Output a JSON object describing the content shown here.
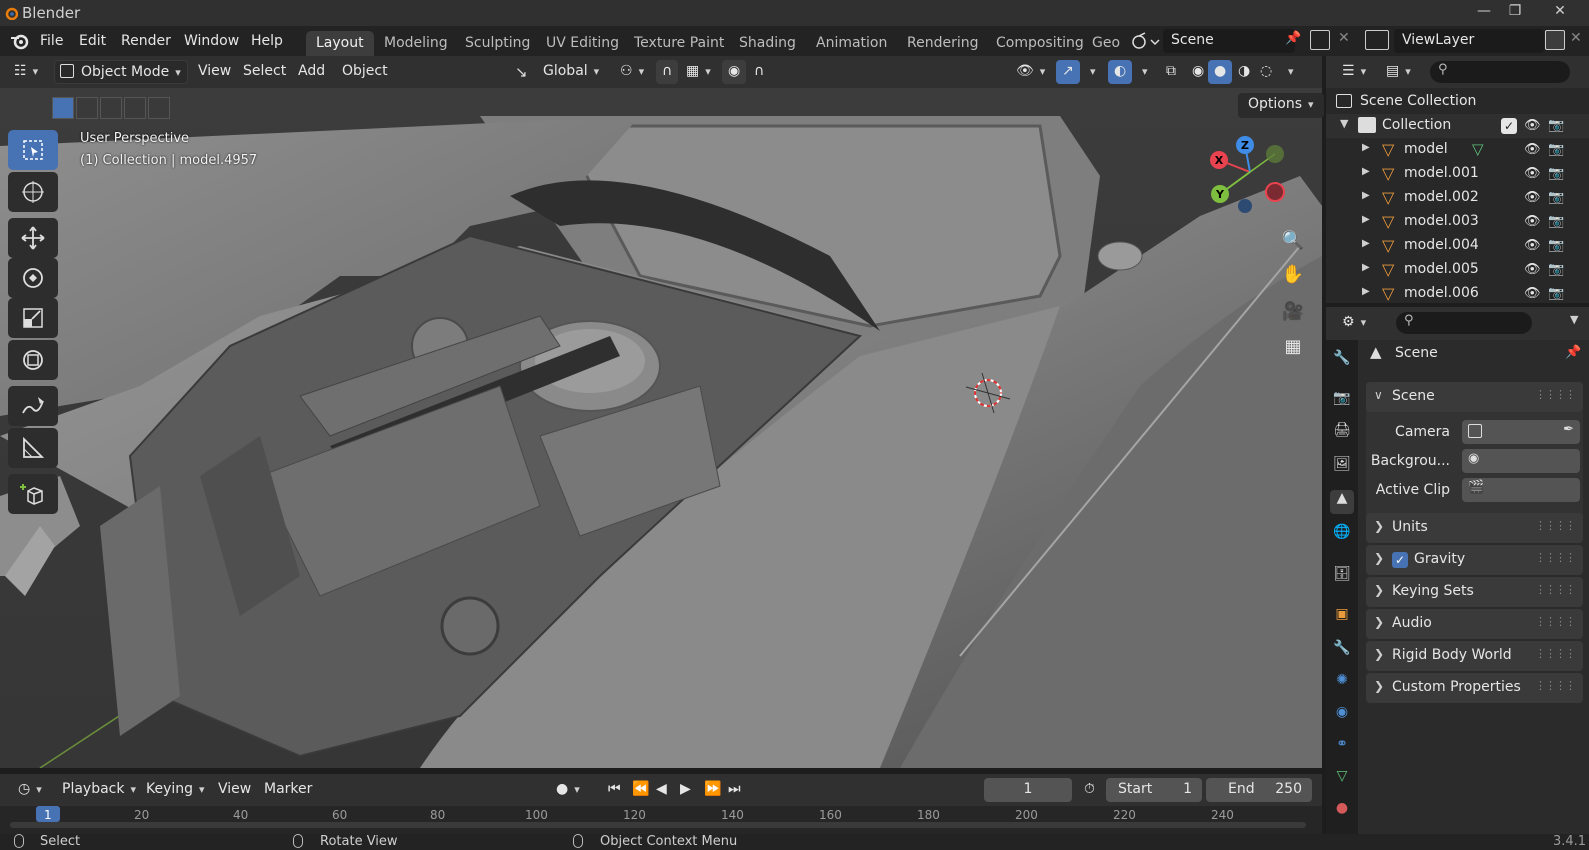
{
  "window": {
    "title": "Blender",
    "version": "3.4.1"
  },
  "menu": {
    "items": [
      "File",
      "Edit",
      "Render",
      "Window",
      "Help"
    ]
  },
  "workspaces": {
    "tabs": [
      "Layout",
      "Modeling",
      "Sculpting",
      "UV Editing",
      "Texture Paint",
      "Shading",
      "Animation",
      "Rendering",
      "Compositing",
      "Geo"
    ],
    "active": "Layout"
  },
  "scene_selector": {
    "value": "Scene"
  },
  "view_layer": {
    "value": "ViewLayer"
  },
  "viewport_header": {
    "mode": "Object Mode",
    "menus": [
      "View",
      "Select",
      "Add",
      "Object"
    ],
    "orientation": "Global",
    "options_label": "Options"
  },
  "viewport_overlay": {
    "perspective": "User Perspective",
    "context": "(1) Collection | model.4957"
  },
  "gizmo": {
    "x": "X",
    "y": "Y",
    "z": "Z"
  },
  "outliner": {
    "root": "Scene Collection",
    "collection": "Collection",
    "items": [
      "model",
      "model.001",
      "model.002",
      "model.003",
      "model.004",
      "model.005",
      "model.006"
    ]
  },
  "properties": {
    "header": "Scene",
    "panel_scene": "Scene",
    "camera_label": "Camera",
    "background_label": "Backgrou...",
    "active_clip_label": "Active Clip",
    "panels": [
      "Units",
      "Gravity",
      "Keying Sets",
      "Audio",
      "Rigid Body World",
      "Custom Properties"
    ],
    "gravity_enabled": true
  },
  "timeline": {
    "menus": [
      "Playback",
      "Keying",
      "View",
      "Marker"
    ],
    "current_frame": "1",
    "start_label": "Start",
    "start": "1",
    "end_label": "End",
    "end": "250",
    "ticks": [
      "1",
      "20",
      "40",
      "60",
      "80",
      "100",
      "120",
      "140",
      "160",
      "180",
      "200",
      "220",
      "240"
    ]
  },
  "statusbar": {
    "select": "Select",
    "rotate": "Rotate View",
    "context_menu": "Object Context Menu",
    "version": "3.4.1"
  },
  "colors": {
    "accent": "#4772b3",
    "x_axis": "#e8434f",
    "y_axis": "#7fbf3f",
    "z_axis": "#3e8ce6"
  }
}
